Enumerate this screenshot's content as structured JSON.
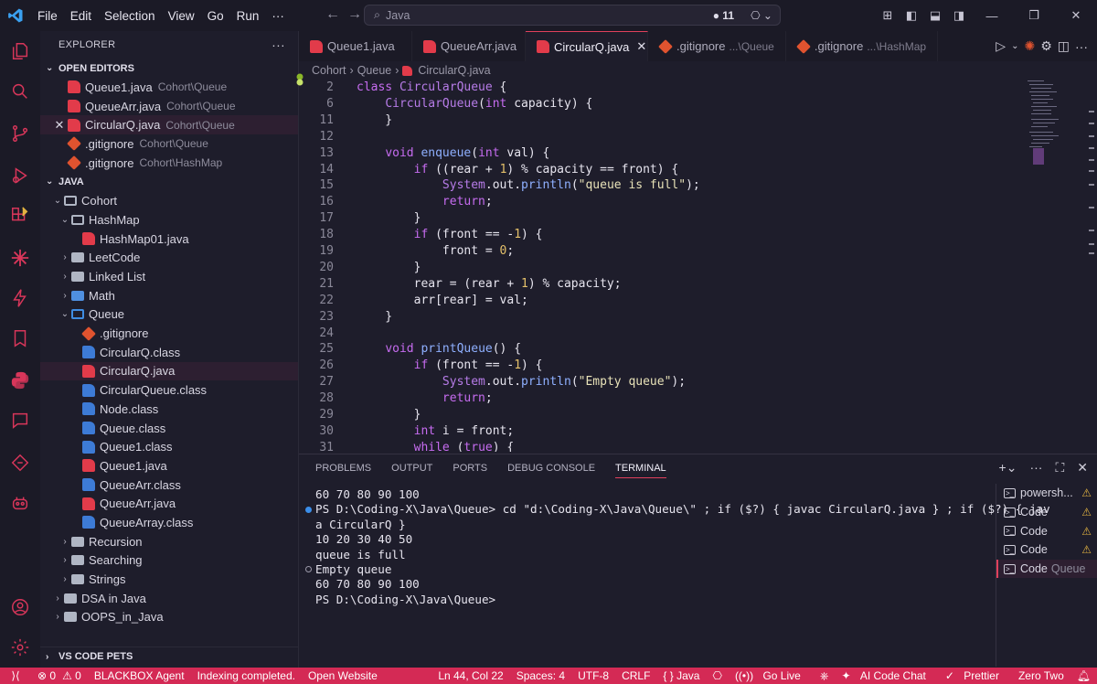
{
  "titlebar": {
    "menu": [
      "File",
      "Edit",
      "Selection",
      "View",
      "Go",
      "Run",
      "···"
    ],
    "search_text": "Java",
    "session_count": "● 11"
  },
  "sidebar": {
    "title": "EXPLORER",
    "open_editors_label": "OPEN EDITORS",
    "open_editors": [
      {
        "name": "Queue1.java",
        "desc": "Cohort\\Queue",
        "icon": "java"
      },
      {
        "name": "QueueArr.java",
        "desc": "Cohort\\Queue",
        "icon": "java"
      },
      {
        "name": "CircularQ.java",
        "desc": "Cohort\\Queue",
        "icon": "java"
      },
      {
        "name": ".gitignore",
        "desc": "Cohort\\Queue",
        "icon": "git"
      },
      {
        "name": ".gitignore",
        "desc": "Cohort\\HashMap",
        "icon": "git"
      }
    ],
    "java_label": "JAVA",
    "tree": {
      "cohort": "Cohort",
      "hashmap": "HashMap",
      "hashmap01": "HashMap01.java",
      "leetcode": "LeetCode",
      "linkedlist": "Linked List",
      "math": "Math",
      "queue": "Queue",
      "queue_files": [
        {
          "name": ".gitignore",
          "icon": "git"
        },
        {
          "name": "CircularQ.class",
          "icon": "class"
        },
        {
          "name": "CircularQ.java",
          "icon": "java"
        },
        {
          "name": "CircularQueue.class",
          "icon": "class"
        },
        {
          "name": "Node.class",
          "icon": "class"
        },
        {
          "name": "Queue.class",
          "icon": "class"
        },
        {
          "name": "Queue1.class",
          "icon": "class"
        },
        {
          "name": "Queue1.java",
          "icon": "java"
        },
        {
          "name": "QueueArr.class",
          "icon": "class"
        },
        {
          "name": "QueueArr.java",
          "icon": "java"
        },
        {
          "name": "QueueArray.class",
          "icon": "class"
        }
      ],
      "recursion": "Recursion",
      "searching": "Searching",
      "strings": "Strings",
      "dsa": "DSA in Java",
      "oops": "OOPS_in_Java"
    },
    "pets_label": "VS CODE PETS"
  },
  "tabs": [
    {
      "name": "Queue1.java",
      "desc": ""
    },
    {
      "name": "QueueArr.java",
      "desc": ""
    },
    {
      "name": "CircularQ.java",
      "desc": ""
    },
    {
      "name": ".gitignore",
      "desc": "...\\Queue"
    },
    {
      "name": ".gitignore",
      "desc": "...\\HashMap"
    }
  ],
  "breadcrumb": [
    "Cohort",
    "Queue",
    "CircularQ.java"
  ],
  "editor": {
    "lines": [
      {
        "n": "2",
        "t": "class CircularQueue {"
      },
      {
        "n": "6",
        "t": "    CircularQueue(int capacity) {"
      },
      {
        "n": "11",
        "t": "    }"
      },
      {
        "n": "12",
        "t": ""
      },
      {
        "n": "13",
        "t": "    void enqueue(int val) {"
      },
      {
        "n": "14",
        "t": "        if ((rear + 1) % capacity == front) {"
      },
      {
        "n": "15",
        "t": "            System.out.println(\"queue is full\");"
      },
      {
        "n": "16",
        "t": "            return;"
      },
      {
        "n": "17",
        "t": "        }"
      },
      {
        "n": "18",
        "t": "        if (front == -1) {"
      },
      {
        "n": "19",
        "t": "            front = 0;"
      },
      {
        "n": "20",
        "t": "        }"
      },
      {
        "n": "21",
        "t": "        rear = (rear + 1) % capacity;"
      },
      {
        "n": "22",
        "t": "        arr[rear] = val;"
      },
      {
        "n": "23",
        "t": "    }"
      },
      {
        "n": "24",
        "t": ""
      },
      {
        "n": "25",
        "t": "    void printQueue() {"
      },
      {
        "n": "26",
        "t": "        if (front == -1) {"
      },
      {
        "n": "27",
        "t": "            System.out.println(\"Empty queue\");"
      },
      {
        "n": "28",
        "t": "            return;"
      },
      {
        "n": "29",
        "t": "        }"
      },
      {
        "n": "30",
        "t": "        int i = front;"
      },
      {
        "n": "31",
        "t": "        while (true) {"
      }
    ]
  },
  "panel": {
    "tabs": [
      "PROBLEMS",
      "OUTPUT",
      "PORTS",
      "DEBUG CONSOLE",
      "TERMINAL"
    ],
    "terminal_lines": [
      "60 70 80 90 100",
      "PS D:\\Coding-X\\Java\\Queue> cd \"d:\\Coding-X\\Java\\Queue\\\" ; if ($?) { javac CircularQ.java } ; if ($?) { jav",
      "a CircularQ }",
      "10 20 30 40 50",
      "queue is full",
      "Empty queue",
      "60 70 80 90 100",
      "PS D:\\Coding-X\\Java\\Queue>"
    ],
    "terminals": [
      {
        "name": "powersh...",
        "desc": "",
        "warn": true
      },
      {
        "name": "Code",
        "desc": "",
        "warn": true
      },
      {
        "name": "Code",
        "desc": "",
        "warn": true
      },
      {
        "name": "Code",
        "desc": "",
        "warn": true
      },
      {
        "name": "Code",
        "desc": "Queue",
        "warn": false
      }
    ]
  },
  "status": {
    "errors": "⊗ 0",
    "warnings": "⚠ 0",
    "blackbox": "BLACKBOX Agent",
    "indexing": "Indexing completed.",
    "website": "Open Website",
    "position": "Ln 44, Col 22",
    "spaces": "Spaces: 4",
    "encoding": "UTF-8",
    "eol": "CRLF",
    "language": "{ } Java",
    "golive": "Go Live",
    "aichat": "AI Code Chat",
    "prettier": "Prettier",
    "theme": "Zero Two"
  },
  "colors": {
    "accent": "#d42a55",
    "java_icon": "#e23b4a",
    "class_icon": "#3d7bd6",
    "git_icon": "#e0532f"
  }
}
